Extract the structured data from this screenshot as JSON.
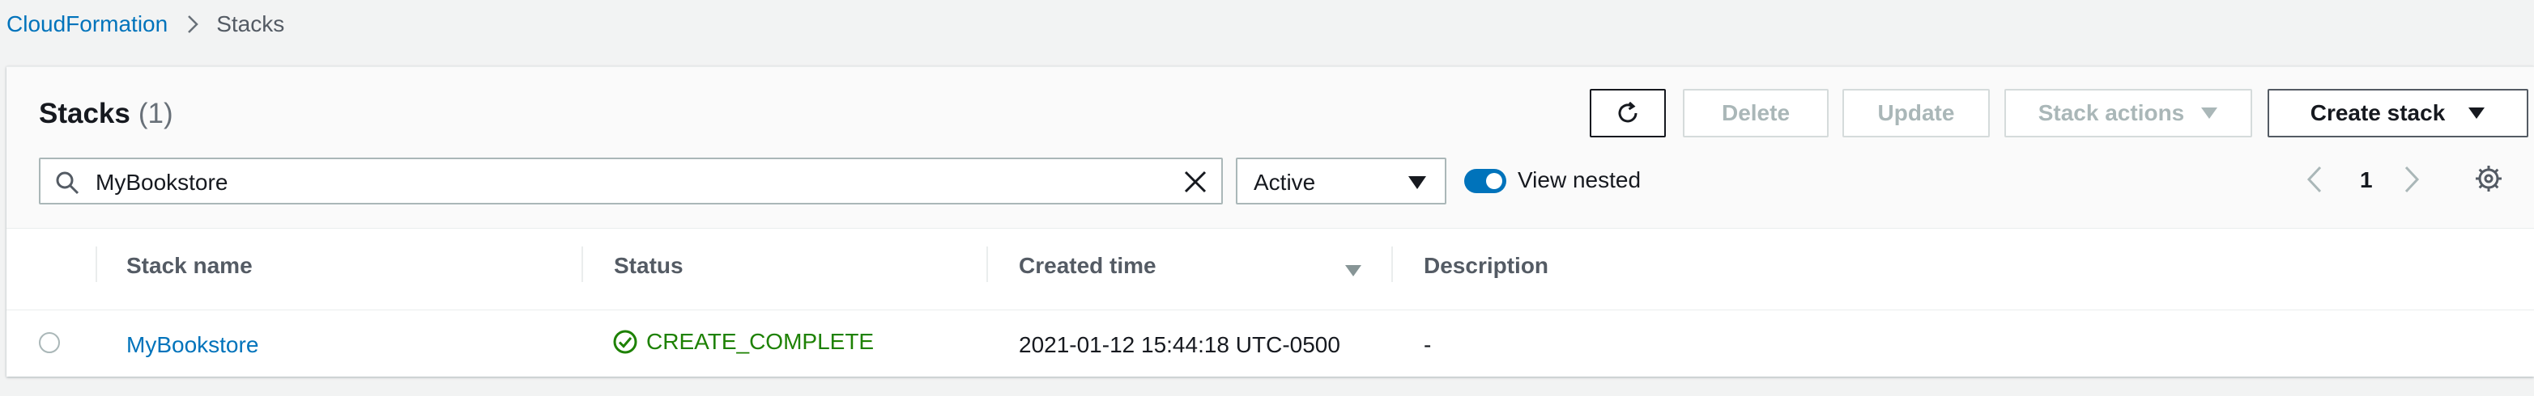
{
  "breadcrumb": {
    "root": "CloudFormation",
    "current": "Stacks"
  },
  "panel": {
    "title": "Stacks",
    "count": "(1)"
  },
  "toolbar": {
    "delete_label": "Delete",
    "update_label": "Update",
    "stack_actions_label": "Stack actions",
    "create_stack_label": "Create stack"
  },
  "filter": {
    "search_value": "MyBookstore",
    "status_select": "Active",
    "view_nested_label": "View nested",
    "view_nested_on": true
  },
  "pagination": {
    "page": "1"
  },
  "table": {
    "columns": [
      "Stack name",
      "Status",
      "Created time",
      "Description"
    ],
    "rows": [
      {
        "stack_name": "MyBookstore",
        "status": "CREATE_COMPLETE",
        "created_time": "2021-01-12 15:44:18 UTC-0500",
        "description": "-"
      }
    ]
  },
  "colors": {
    "link": "#0073bb",
    "success": "#1d8102",
    "toggle": "#0073bb"
  },
  "icons": [
    "chevron-right-icon",
    "refresh-icon",
    "caret-down-icon",
    "search-icon",
    "clear-icon",
    "angle-left-icon",
    "angle-right-icon",
    "gear-icon",
    "sort-icon",
    "status-ok-icon"
  ]
}
